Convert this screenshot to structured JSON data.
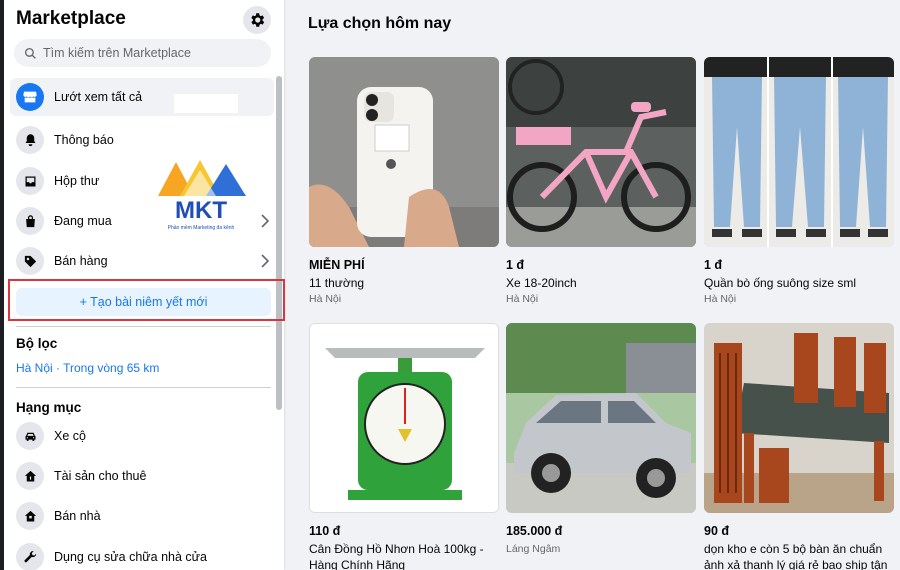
{
  "sidebar": {
    "title": "Marketplace",
    "search_placeholder": "Tìm kiếm trên Marketplace",
    "nav": [
      {
        "label": "Lướt xem tất cả",
        "icon": "storefront-icon"
      },
      {
        "label": "Thông báo",
        "icon": "bell-icon"
      },
      {
        "label": "Hộp thư",
        "icon": "inbox-icon"
      },
      {
        "label": "Đang mua",
        "icon": "shopping-bag-icon"
      },
      {
        "label": "Bán hàng",
        "icon": "price-tag-icon"
      }
    ],
    "create_listing": "+ Tạo bài niêm yết mới",
    "filter_heading": "Bộ lọc",
    "filter_location": "Hà Nội · Trong vòng 65 km",
    "category_heading": "Hạng mục",
    "categories": [
      {
        "label": "Xe cộ",
        "icon": "car-icon"
      },
      {
        "label": "Tài sản cho thuê",
        "icon": "house-rent-icon"
      },
      {
        "label": "Bán nhà",
        "icon": "house-sale-icon"
      },
      {
        "label": "Dụng cụ sửa chữa nhà cửa",
        "icon": "wrench-icon"
      }
    ],
    "logo_text": "MKT",
    "logo_tagline": "Phần mềm Marketing đa kênh"
  },
  "main": {
    "title": "Lựa chọn hôm nay",
    "listings": [
      {
        "price": "MIỄN PHÍ",
        "title": "11 thường",
        "location": "Hà Nội"
      },
      {
        "price": "1 đ",
        "title": "Xe 18-20inch",
        "location": "Hà Nội"
      },
      {
        "price": "1 đ",
        "title": "Quần bò ống suông size sml",
        "location": "Hà Nội"
      },
      {
        "price": "110 đ",
        "title": "Cân Đồng Hồ Nhơn Hoà 100kg - Hàng Chính Hãng",
        "location": ""
      },
      {
        "price": "185.000 đ",
        "title": "Láng Ngâm",
        "location": ""
      },
      {
        "price": "90 đ",
        "title": "dọn kho e còn 5 bộ bàn ăn chuẩn ảnh xả thanh lý giá rẻ bao ship tận",
        "location": ""
      }
    ]
  },
  "colors": {
    "accent": "#1877f2",
    "highlight_border": "#d9363e"
  }
}
